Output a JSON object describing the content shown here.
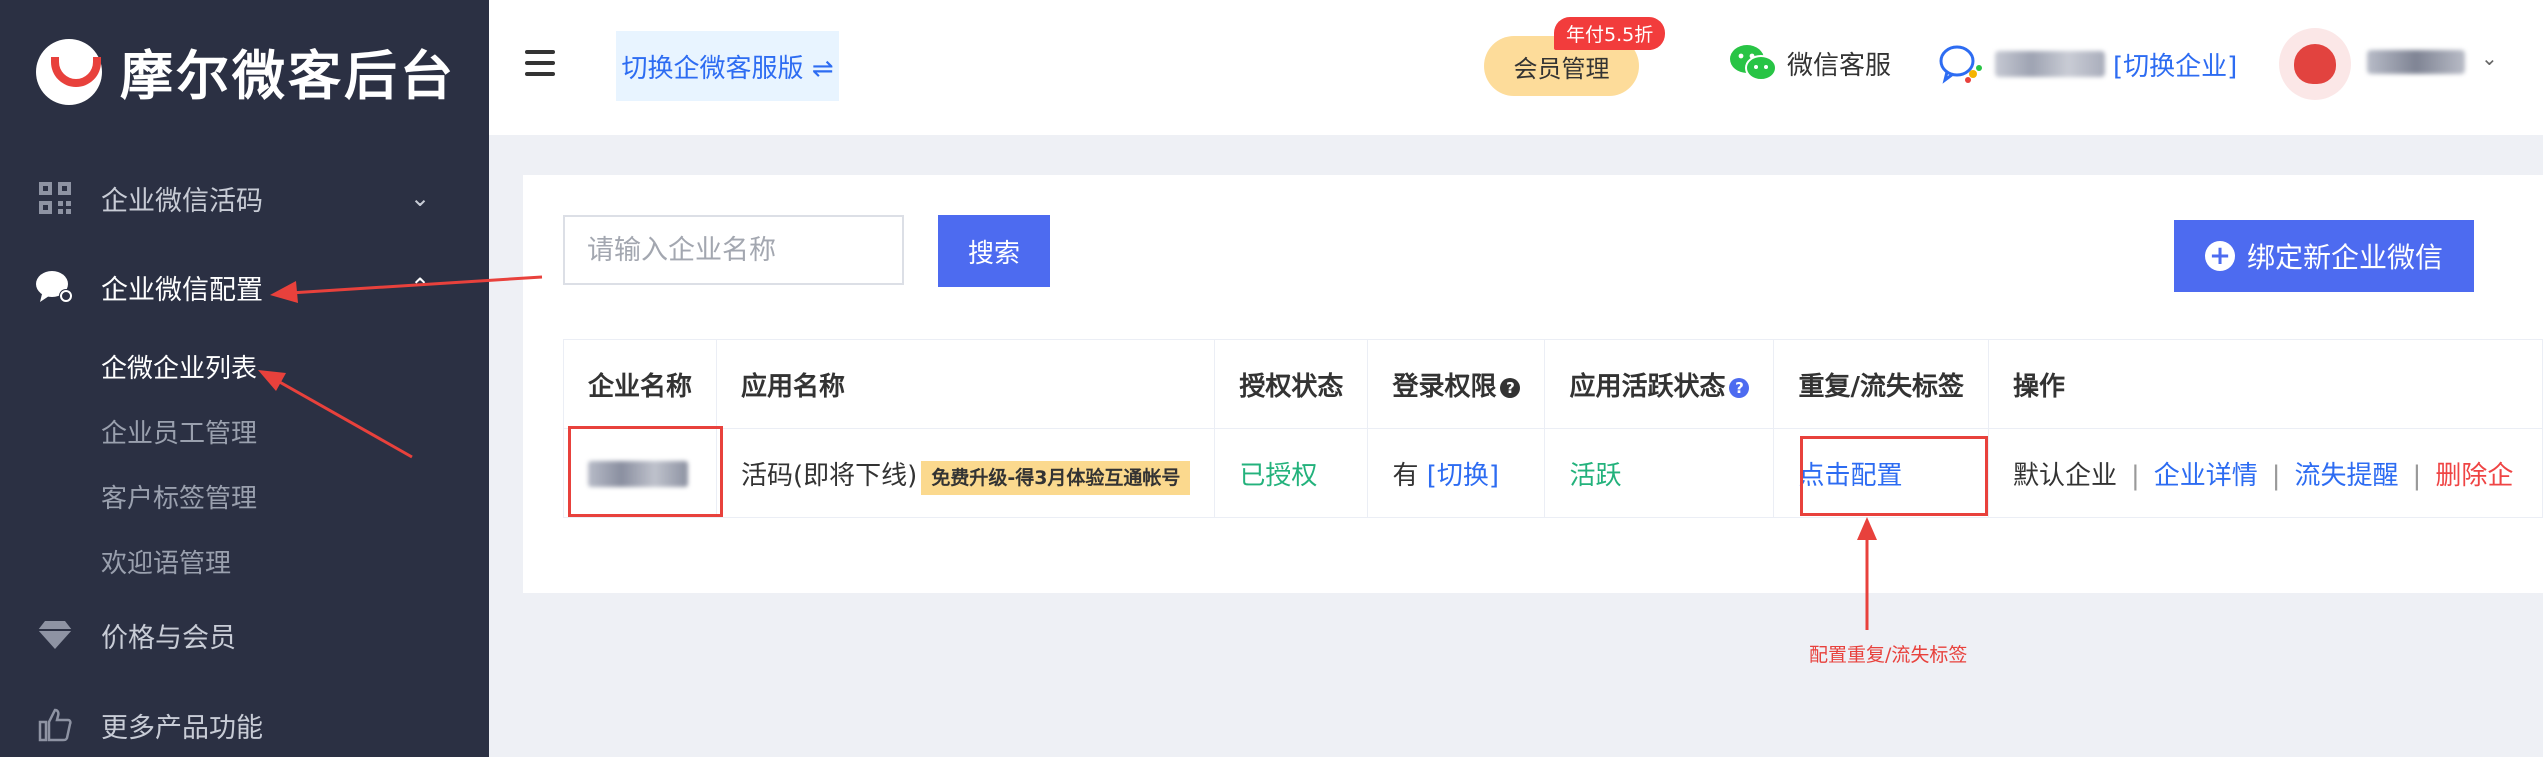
{
  "sidebar": {
    "brand": "摩尔微客后台",
    "items": [
      {
        "label": "企业微信活码",
        "icon": "qrcode-icon"
      },
      {
        "label": "企业微信配置",
        "icon": "chat-bubble-icon"
      },
      {
        "label": "价格与会员",
        "icon": "diamond-icon"
      },
      {
        "label": "更多产品功能",
        "icon": "thumbs-up-icon"
      }
    ],
    "sub_items": [
      "企微企业列表",
      "企业员工管理",
      "客户标签管理",
      "欢迎语管理"
    ]
  },
  "header": {
    "switch_label": "切换企微客服版 ⇌",
    "member_label": "会员管理",
    "member_badge": "年付5.5折",
    "wechat_cs": "微信客服",
    "switch_company": "[切换企业]"
  },
  "toolbar": {
    "search_placeholder": "请输入企业名称",
    "search_label": "搜索",
    "bind_label": "绑定新企业微信"
  },
  "table": {
    "headers": [
      "企业名称",
      "应用名称",
      "授权状态",
      "登录权限",
      "应用活跃状态",
      "重复/流失标签",
      "操作"
    ],
    "row": {
      "app_name": "活码(即将下线)",
      "promo": "免费升级-得3月体验互通帐号",
      "auth_status": "已授权",
      "login_perm": "有",
      "login_switch": "[切换]",
      "active_status": "活跃",
      "config_link": "点击配置",
      "actions": [
        "默认企业",
        "企业详情",
        "流失提醒",
        "删除企"
      ]
    }
  },
  "annotation": "配置重复/流失标签",
  "colors": {
    "accent": "#4d6bf0",
    "sidebar": "#2b3043",
    "annotation": "#e8413c",
    "success": "#23b27c"
  }
}
